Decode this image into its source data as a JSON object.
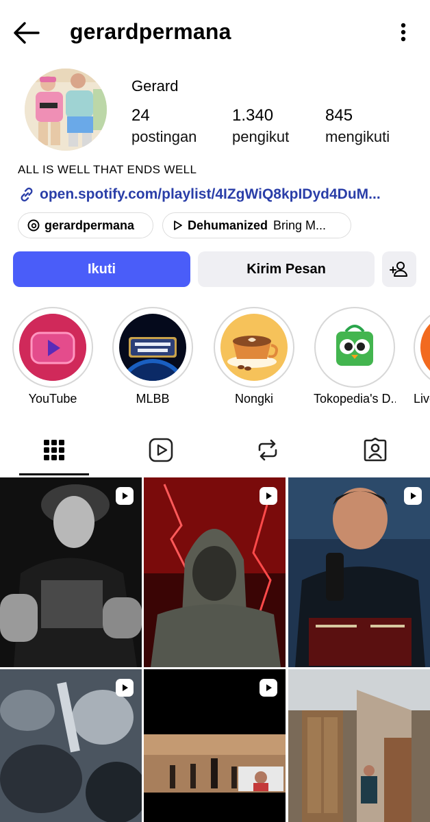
{
  "header": {
    "username": "gerardpermana",
    "back_icon": "arrow-left-icon",
    "more_icon": "more-vertical-icon"
  },
  "profile": {
    "display_name": "Gerard",
    "stats": [
      {
        "value": "24",
        "label": "postingan"
      },
      {
        "value": "1.340",
        "label": "pengikut"
      },
      {
        "value": "845",
        "label": "mengikuti"
      }
    ],
    "bio": "ALL IS WELL THAT ENDS WELL",
    "link": "open.spotify.com/playlist/4IZgWiQ8kpIDyd4DuM...",
    "threads_handle": "gerardpermana",
    "music_title": "Dehumanized",
    "music_artist": "Bring M..."
  },
  "actions": {
    "follow_label": "Ikuti",
    "message_label": "Kirim Pesan",
    "add_user_icon": "add-person-icon"
  },
  "highlights": [
    {
      "label": "YouTube"
    },
    {
      "label": "MLBB"
    },
    {
      "label": "Nongki"
    },
    {
      "label": "Tokopedia's D..."
    },
    {
      "label": "Live"
    }
  ],
  "tabs": [
    {
      "icon": "grid-icon",
      "active": true
    },
    {
      "icon": "reels-icon",
      "active": false
    },
    {
      "icon": "repost-icon",
      "active": false
    },
    {
      "icon": "tagged-icon",
      "active": false
    }
  ],
  "colors": {
    "accent": "#4a5df9",
    "link": "#2a3ea8",
    "secondary_button": "#efeff3"
  }
}
